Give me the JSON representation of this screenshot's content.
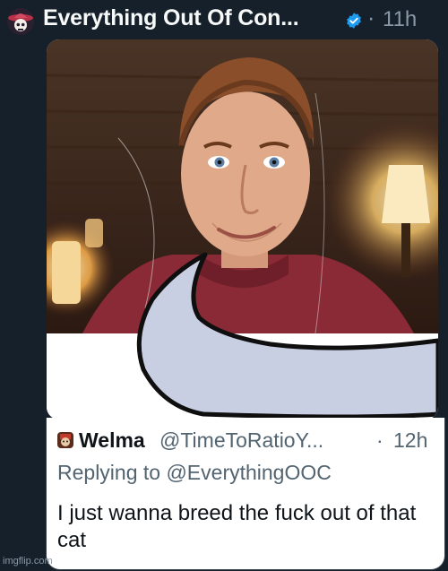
{
  "tweet": {
    "author_name": "Everything Out Of Con...",
    "separator": "·",
    "timestamp": "11h",
    "verified": true,
    "avatar_icon": "skull-sombrero-avatar"
  },
  "media": {
    "speech_bubble_color": "#c9cfe3"
  },
  "quoted_tweet": {
    "author_name": "Welma",
    "handle": "@TimeToRatioY...",
    "separator": "·",
    "timestamp": "12h",
    "replying_to": "Replying to @EverythingOOC",
    "text": "I just wanna breed the fuck out of that cat"
  },
  "watermark": "imgflip.com",
  "colors": {
    "background": "#15202b",
    "verified_badge": "#1d9bf0",
    "secondary_text": "#8b98a5"
  }
}
